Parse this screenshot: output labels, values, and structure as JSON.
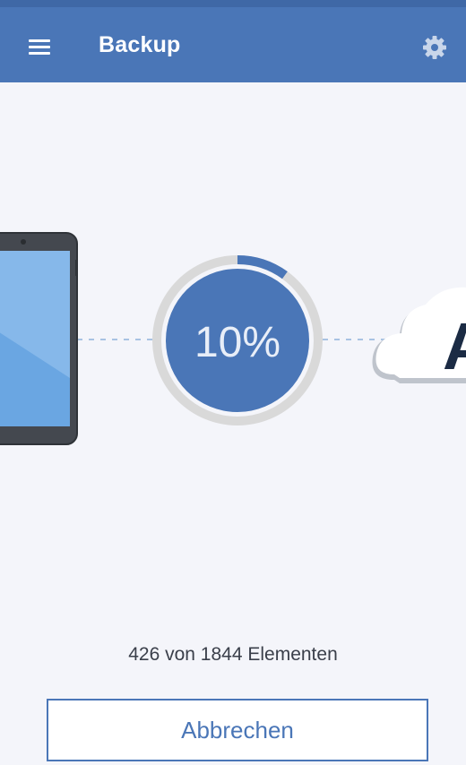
{
  "header": {
    "title": "Backup",
    "menu_icon": "menu-icon",
    "settings_icon": "gear-icon"
  },
  "progress": {
    "percent_label": "10%",
    "fraction": 0.1,
    "status": "426 von 1844 Elementen"
  },
  "illustration": {
    "source_icon": "phone-icon",
    "destination_icon": "cloud-icon",
    "cloud_logo_letter": "A"
  },
  "actions": {
    "cancel_label": "Abbrechen"
  },
  "colors": {
    "primary": "#4a76b7",
    "background": "#f4f5fa",
    "ring_track": "#d9d9d9"
  }
}
